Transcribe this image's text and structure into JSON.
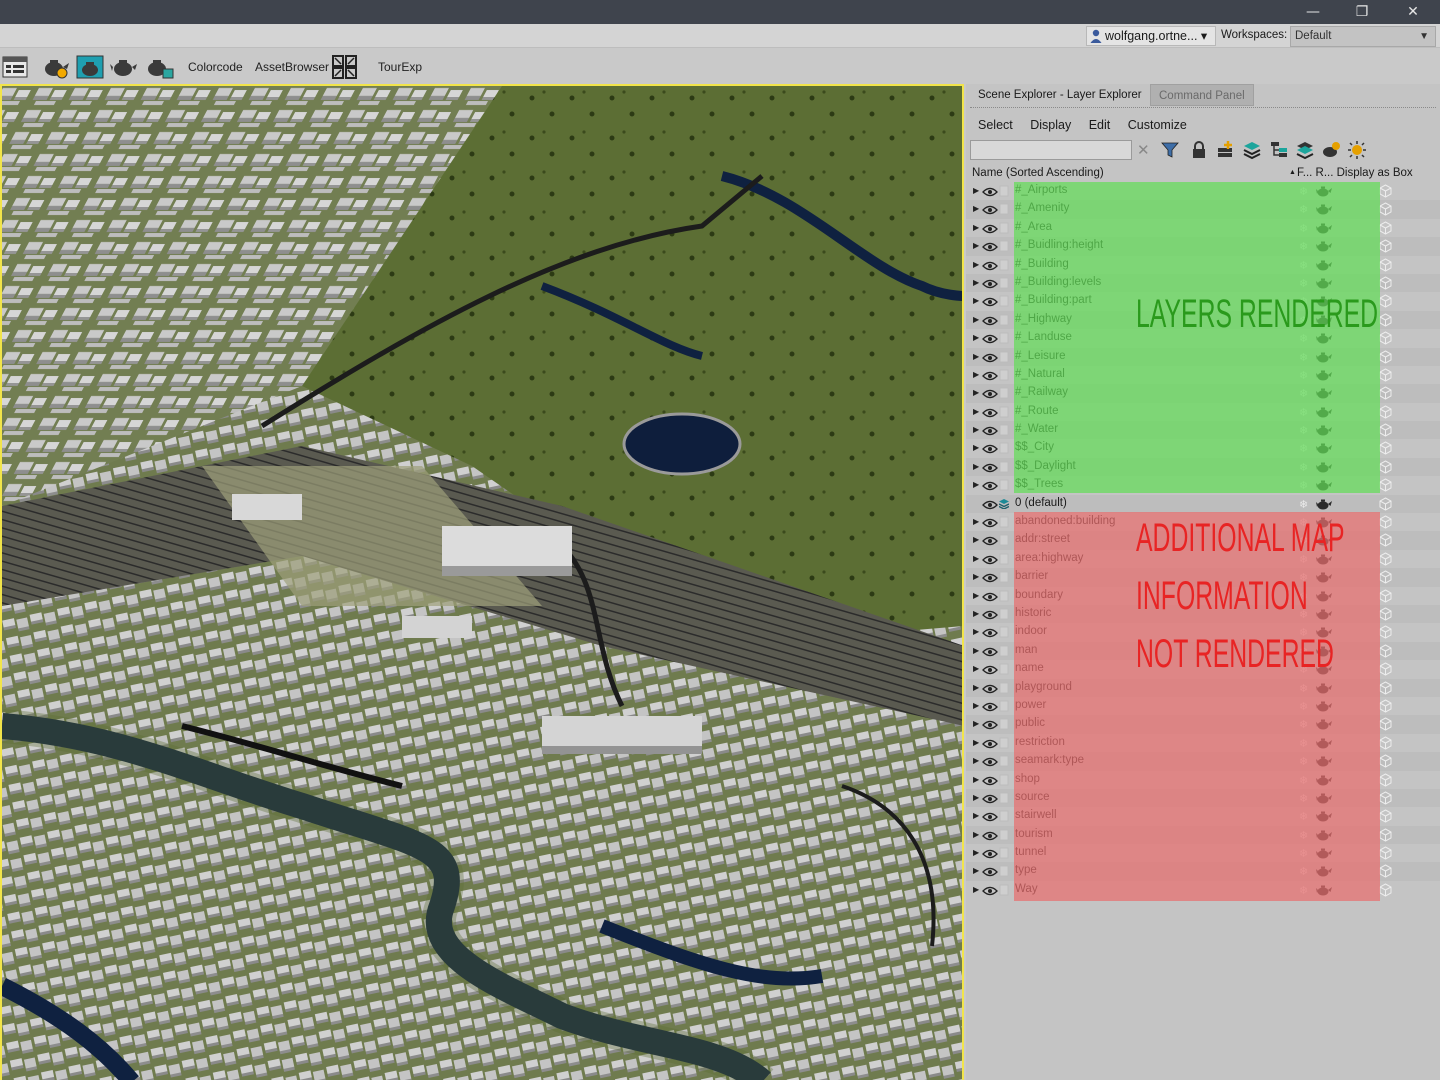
{
  "window": {
    "minimize": "—",
    "restore": "❐",
    "close": "✕"
  },
  "userbar": {
    "user": "wolfgang.ortne...",
    "user_arrow": "▾",
    "workspaces_label": "Workspaces:",
    "workspace_value": "Default",
    "workspace_arrow": "▼"
  },
  "toolbar": {
    "colorcode": "Colorcode",
    "asset_browser": "AssetBrowser",
    "tourexp": "TourExp"
  },
  "panel": {
    "tabs": [
      {
        "label": "Scene Explorer - Layer Explorer"
      },
      {
        "label": "Command Panel"
      }
    ],
    "menus": [
      "Select",
      "Display",
      "Edit",
      "Customize"
    ],
    "search_placeholder": "",
    "columns": {
      "name": "Name (Sorted Ascending)",
      "sort_arrow": "▲",
      "rest": "F...  R... Display as Box"
    },
    "layers": [
      {
        "name": "#_Airports",
        "group": "rendered"
      },
      {
        "name": "#_Amenity",
        "group": "rendered"
      },
      {
        "name": "#_Area",
        "group": "rendered"
      },
      {
        "name": "#_Buidling:height",
        "group": "rendered"
      },
      {
        "name": "#_Building",
        "group": "rendered"
      },
      {
        "name": "#_Building:levels",
        "group": "rendered"
      },
      {
        "name": "#_Building:part",
        "group": "rendered"
      },
      {
        "name": "#_Highway",
        "group": "rendered"
      },
      {
        "name": "#_Landuse",
        "group": "rendered"
      },
      {
        "name": "#_Leisure",
        "group": "rendered"
      },
      {
        "name": "#_Natural",
        "group": "rendered"
      },
      {
        "name": "#_Railway",
        "group": "rendered"
      },
      {
        "name": "#_Route",
        "group": "rendered"
      },
      {
        "name": "#_Water",
        "group": "rendered"
      },
      {
        "name": "$$_City",
        "group": "rendered"
      },
      {
        "name": "$$_Daylight",
        "group": "rendered"
      },
      {
        "name": "$$_Trees",
        "group": "rendered"
      },
      {
        "name": "0 (default)",
        "group": "default"
      },
      {
        "name": "abandoned:building",
        "group": "not-rendered"
      },
      {
        "name": "addr:street",
        "group": "not-rendered"
      },
      {
        "name": "area:highway",
        "group": "not-rendered"
      },
      {
        "name": "barrier",
        "group": "not-rendered"
      },
      {
        "name": "boundary",
        "group": "not-rendered"
      },
      {
        "name": "historic",
        "group": "not-rendered"
      },
      {
        "name": "indoor",
        "group": "not-rendered"
      },
      {
        "name": "man",
        "group": "not-rendered"
      },
      {
        "name": "name",
        "group": "not-rendered"
      },
      {
        "name": "playground",
        "group": "not-rendered"
      },
      {
        "name": "power",
        "group": "not-rendered"
      },
      {
        "name": "public",
        "group": "not-rendered"
      },
      {
        "name": "restriction",
        "group": "not-rendered"
      },
      {
        "name": "seamark:type",
        "group": "not-rendered"
      },
      {
        "name": "shop",
        "group": "not-rendered"
      },
      {
        "name": "source",
        "group": "not-rendered"
      },
      {
        "name": "stairwell",
        "group": "not-rendered"
      },
      {
        "name": "tourism",
        "group": "not-rendered"
      },
      {
        "name": "tunnel",
        "group": "not-rendered"
      },
      {
        "name": "type",
        "group": "not-rendered"
      },
      {
        "name": "Way",
        "group": "not-rendered"
      }
    ]
  },
  "annotations": {
    "rendered": "LAYERS RENDERED",
    "additional_1": "ADDITIONAL MAP",
    "additional_2": "INFORMATION",
    "additional_3": "NOT RENDERED"
  },
  "colors": {
    "rendered_highlight": "#62dc58",
    "not_rendered_highlight": "#e86e6e",
    "viewport_border": "#f1e44a",
    "titlebar": "#3f444d"
  }
}
